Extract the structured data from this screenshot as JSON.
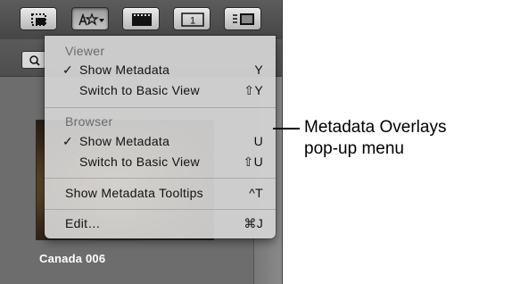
{
  "menu": {
    "sections": [
      {
        "header": "Viewer",
        "items": [
          {
            "check": "✓",
            "label": "Show Metadata",
            "shortcut": "Y"
          },
          {
            "check": "",
            "label": "Switch to Basic View",
            "shortcut": "⇧Y"
          }
        ]
      },
      {
        "header": "Browser",
        "items": [
          {
            "check": "✓",
            "label": "Show Metadata",
            "shortcut": "U"
          },
          {
            "check": "",
            "label": "Switch to Basic View",
            "shortcut": "⇧U"
          }
        ]
      }
    ],
    "tooltips_item": {
      "label": "Show Metadata Tooltips",
      "shortcut": "^T"
    },
    "edit_item": {
      "label": "Edit…",
      "shortcut": "⌘J"
    }
  },
  "photo": {
    "caption": "Canada 006"
  },
  "callout": {
    "line1": "Metadata Overlays",
    "line2": "pop-up menu"
  },
  "toolbar": {
    "buttons": [
      {
        "icon": "crop-frame-icon"
      },
      {
        "icon": "metadata-overlays-icon",
        "has_dropdown": true,
        "pressed": true
      },
      {
        "icon": "filmstrip-icon"
      },
      {
        "icon": "single-view-icon",
        "text": "1"
      },
      {
        "icon": "list-view-icon"
      }
    ]
  },
  "colors": {
    "menu_bg": "#d4d4d4",
    "panel_bg": "#6d6d6d",
    "toolbar_bg": "#4e4e4e"
  }
}
